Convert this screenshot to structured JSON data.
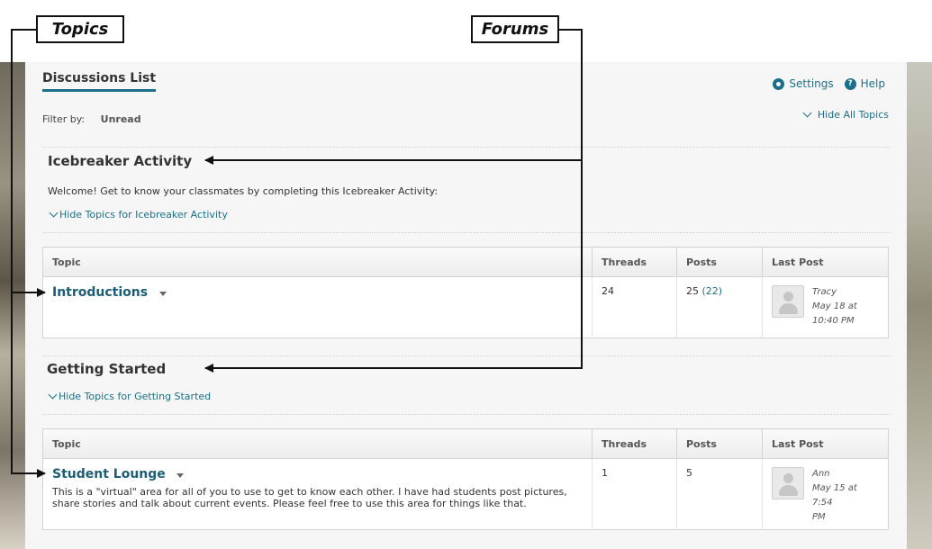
{
  "callouts": {
    "topics": "Topics",
    "forums": "Forums"
  },
  "header": {
    "title": "Discussions List",
    "settings": "Settings",
    "help": "Help",
    "help_glyph": "?",
    "filter_label": "Filter by:",
    "filter_value": "Unread",
    "hide_all": "Hide All Topics"
  },
  "table_headers": {
    "topic": "Topic",
    "threads": "Threads",
    "posts": "Posts",
    "last_post": "Last Post"
  },
  "forums": [
    {
      "title": "Icebreaker Activity",
      "description": "Welcome! Get to know your classmates by completing this Icebreaker Activity:",
      "hide_link": "Hide Topics for Icebreaker Activity",
      "topics": [
        {
          "name": "Introductions",
          "description": "",
          "threads": "24",
          "posts": "25",
          "unread": "(22)",
          "last_author": "Tracy",
          "last_date": "May 18 at",
          "last_time": "10:40 PM"
        }
      ]
    },
    {
      "title": "Getting Started",
      "description": "",
      "hide_link": "Hide Topics for Getting Started",
      "topics": [
        {
          "name": "Student Lounge",
          "description": "This is a \"virtual\" area for all of you to use to get to know each other. I have had students post pictures, share stories and talk about current events. Please feel free to use this area for things like that.",
          "threads": "1",
          "posts": "5",
          "unread": "",
          "last_author": "Ann",
          "last_date": "May 15 at 7:54",
          "last_time": "PM"
        }
      ]
    }
  ],
  "colors": {
    "link": "#1b6f8a",
    "topic_title": "#1b5e7a",
    "panel_bg": "#f6f6f6"
  },
  "icons": [
    "gear-icon",
    "help-icon",
    "chevron-down-icon",
    "avatar-icon",
    "dropdown-arrow-icon"
  ]
}
